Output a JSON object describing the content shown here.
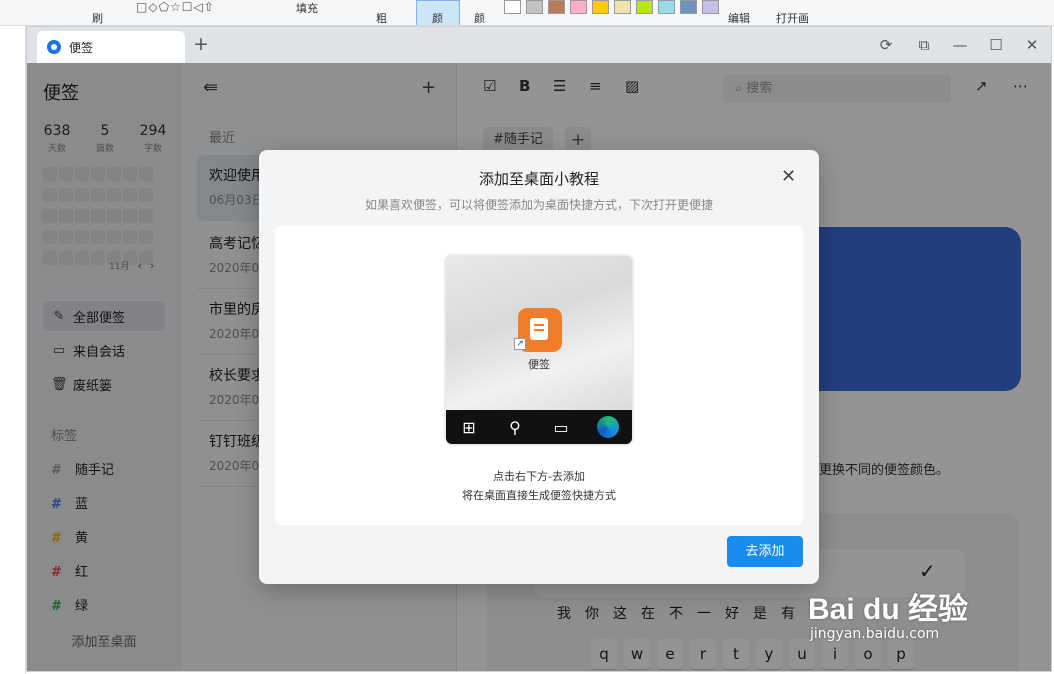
{
  "paint_ribbon": {
    "brush_label": "刷",
    "fill_label": "填充",
    "size_label": "粗",
    "color1_label": "颜",
    "color2_label": "颜",
    "edit_label": "编辑",
    "open_label": "打开画",
    "swatches": [
      "#ffffff",
      "#c3c3c3",
      "#b97a57",
      "#ffaec9",
      "#ffc90e",
      "#efe4b0",
      "#b5e61d",
      "#99d9ea",
      "#7092be",
      "#c8bfe7"
    ]
  },
  "browser": {
    "tab_title": "便签",
    "new_tab": "+",
    "controls": [
      "⟳",
      "⧉",
      "—",
      "☐",
      "✕"
    ]
  },
  "sidebar": {
    "title": "便签",
    "stats": [
      {
        "value": "638",
        "label": "天数"
      },
      {
        "value": "5",
        "label": "篇数"
      },
      {
        "value": "294",
        "label": "字数"
      }
    ],
    "month": "11月",
    "nav": [
      {
        "label": "全部便签",
        "icon": "note-edit-icon",
        "active": true
      },
      {
        "label": "来自会话",
        "icon": "chat-icon",
        "active": false
      },
      {
        "label": "废纸篓",
        "icon": "trash-icon",
        "active": false
      }
    ],
    "tags_header": "标签",
    "tags": [
      {
        "label": "随手记",
        "color": "#999999"
      },
      {
        "label": "蓝",
        "color": "#3b7ae0"
      },
      {
        "label": "黄",
        "color": "#f5b400"
      },
      {
        "label": "红",
        "color": "#e5484d"
      },
      {
        "label": "绿",
        "color": "#2fb344"
      }
    ],
    "add_to_desktop": "添加至桌面"
  },
  "note_list": {
    "section": "最近",
    "notes": [
      {
        "title": "欢迎使用",
        "date": "06月03日"
      },
      {
        "title": "高考记忆",
        "date": "2020年0"
      },
      {
        "title": "市里的房",
        "date": "2020年0"
      },
      {
        "title": "校长要求",
        "date": "2020年0"
      },
      {
        "title": "钉钉班级",
        "date": "2020年0"
      }
    ]
  },
  "editor": {
    "search_placeholder": "搜索",
    "tag_chip": "#随手记",
    "tip_text": "更换不同的便签颜色。",
    "keyboard_suggestions": "我你这在不一好是有",
    "keyboard_row": [
      "q",
      "w",
      "e",
      "r",
      "t",
      "y",
      "u",
      "i",
      "o",
      "p"
    ]
  },
  "modal": {
    "title": "添加至桌面小教程",
    "subtitle": "如果喜欢便签，可以将便签添加为桌面快捷方式，下次打开更便捷",
    "app_name": "便签",
    "hint_line1": "点击右下方-去添加",
    "hint_line2": "将在桌面直接生成便签快捷方式",
    "button": "去添加"
  },
  "watermark": {
    "brand": "Bai du 经验",
    "url": "jingyan.baidu.com"
  }
}
